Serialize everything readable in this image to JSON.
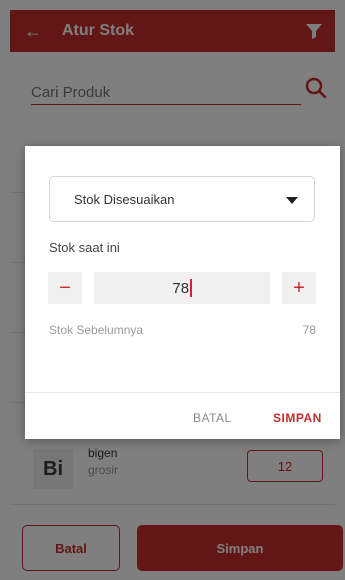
{
  "header": {
    "title": "Atur Stok",
    "back_icon": "arrow-left-icon",
    "filter_icon": "filter-icon"
  },
  "search": {
    "placeholder": "Cari Produk",
    "icon": "search-icon"
  },
  "product": {
    "initials": "Bi",
    "name": "bigen",
    "category": "grosir",
    "quantity": "12"
  },
  "footer": {
    "cancel_label": "Batal",
    "save_label": "Simpan"
  },
  "dialog": {
    "type_selected": "Stok Disesuaikan",
    "current_stock_label": "Stok saat ini",
    "current_stock_value": "78",
    "previous_stock_label": "Stok Sebelumnya",
    "previous_stock_value": "78",
    "cancel_label": "BATAL",
    "save_label": "SIMPAN",
    "minus_label": "−",
    "plus_label": "+"
  },
  "colors": {
    "accent": "#c62d2c"
  }
}
